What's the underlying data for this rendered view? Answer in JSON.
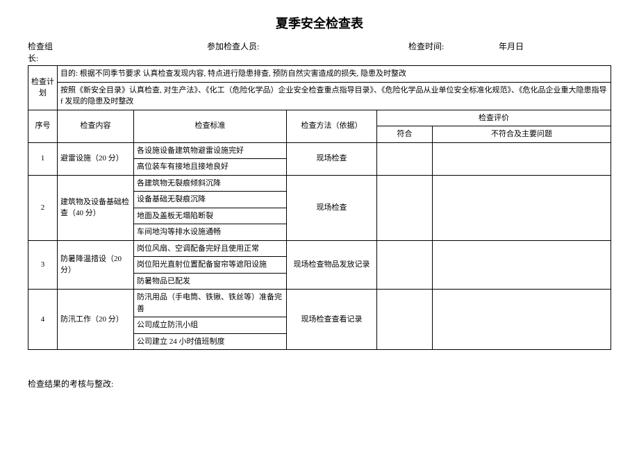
{
  "title": "夏季安全检查表",
  "header": {
    "leader_label": "检查组长:",
    "leader_value": "",
    "members_label": "参加检查人员:",
    "members_value": "",
    "time_label": "检查时间:",
    "time_value": "",
    "date_label": "年月日"
  },
  "plan": {
    "label": "检查计划",
    "line1": "目的: 根据不同季节要求 认真检查发现内容, 特点进行隐患排查, 预防自然灾害造成的损失, 隐患及时整改",
    "line2": "按照《新安全目录》认真检查, 对生产法》、《化工（危险化学品）企业安全检查重点指导目录》、《危险化学品从业单位安全标准化规范》、《危化品企业重大隐患指导 f 发现的隐患及时整改"
  },
  "columns": {
    "seq": "序号",
    "content": "检查内容",
    "standard": "检查标准",
    "method": "检查方法（依据）",
    "eval": "检查评价",
    "ok": "符合",
    "ng": "不符合及主要问题"
  },
  "rows": [
    {
      "seq": "1",
      "content": "避雷设施（20 分）",
      "standards": [
        "各设施设备建筑物避雷设施完好",
        "高位装车有接地且接地良好"
      ],
      "method": "现场检查"
    },
    {
      "seq": "2",
      "content": "建筑物及设备基础检查（40 分）",
      "standards": [
        "各建筑物无裂痕倾斜沉降",
        "设备基础无裂痕沉降",
        "地面及盖板无塌陷断裂",
        "车间地沟等排水设施通畅"
      ],
      "method": "现场检查"
    },
    {
      "seq": "3",
      "content": "防暑降温措设（20 分）",
      "standards": [
        "岗位风扇、空调配备完好且使用正常",
        "岗位阳光直射位置配备窗帘等遮阳设施",
        "防暑物品已配发"
      ],
      "method": "现场检查物品发放记录"
    },
    {
      "seq": "4",
      "content": "防汛工作（20 分）",
      "standards": [
        "防汛用品（手电筒、铁锹、铁丝等）准备完善",
        "公司成立防汛小组",
        "公司建立 24 小时值班制度"
      ],
      "method": "现场检查查看记录"
    }
  ],
  "footer": "检查结果的考核与整改:"
}
